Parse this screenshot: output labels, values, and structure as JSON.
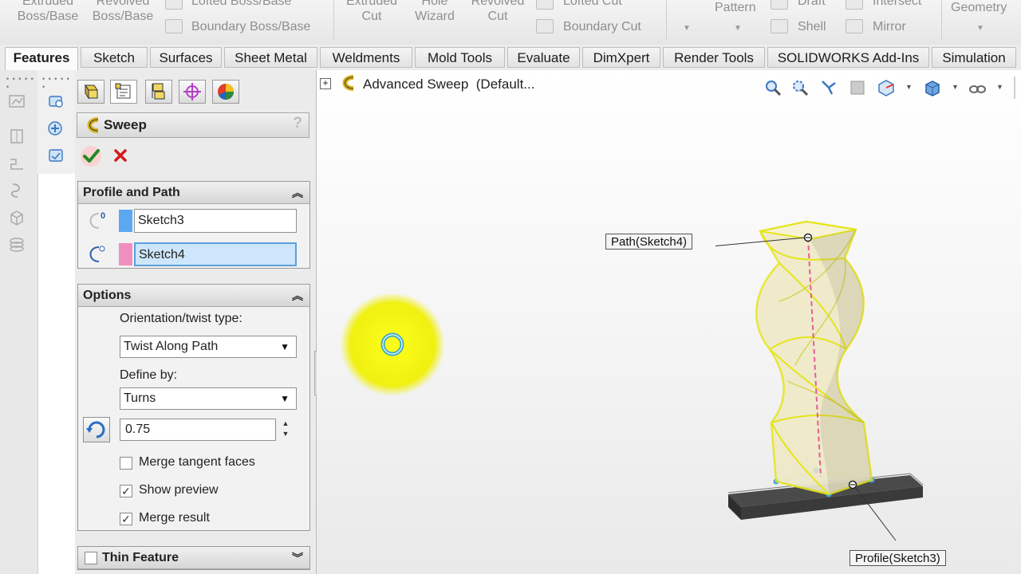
{
  "ribbon": {
    "extruded_boss": "Extruded\nBoss/Base",
    "revolved_boss": "Revolved\nBoss/Base",
    "lofted_boss": "Lofted Boss/Base",
    "boundary_boss": "Boundary Boss/Base",
    "extruded_cut": "Extruded\nCut",
    "hole_wizard": "Hole\nWizard",
    "revolved_cut": "Revolved\nCut",
    "lofted_cut": "Lofted Cut",
    "boundary_cut": "Boundary Cut",
    "pattern": "Pattern",
    "draft": "Draft",
    "shell": "Shell",
    "intersect": "Intersect",
    "mirror": "Mirror",
    "geometry": "Geometry"
  },
  "tabs": [
    {
      "label": "Features",
      "active": true
    },
    {
      "label": "Sketch"
    },
    {
      "label": "Surfaces"
    },
    {
      "label": "Sheet Metal"
    },
    {
      "label": "Weldments"
    },
    {
      "label": "Mold Tools"
    },
    {
      "label": "Evaluate"
    },
    {
      "label": "DimXpert"
    },
    {
      "label": "Render Tools"
    },
    {
      "label": "SOLIDWORKS Add-Ins"
    },
    {
      "label": "Simulation"
    }
  ],
  "property_manager": {
    "title": "Sweep",
    "help": "?",
    "profile_and_path": {
      "header": "Profile and Path",
      "profile_value": "Sketch3",
      "profile_color": "#5aa9f0",
      "path_value": "Sketch4",
      "path_color": "#f08fbf",
      "profile_badge": "0"
    },
    "options": {
      "header": "Options",
      "orientation_label": "Orientation/twist type:",
      "orientation_value": "Twist Along Path",
      "define_label": "Define by:",
      "define_value": "Turns",
      "turns_value": "0.75",
      "merge_tangent_label": "Merge tangent faces",
      "merge_tangent_checked": false,
      "show_preview_label": "Show preview",
      "show_preview_checked": true,
      "merge_result_label": "Merge result",
      "merge_result_checked": true
    },
    "thin_feature": {
      "header": "Thin Feature",
      "checked": false
    }
  },
  "graphics": {
    "tree_item": "Advanced Sweep  (Default...",
    "path_callout": "Path(Sketch4)",
    "profile_callout": "Profile(Sketch3)"
  },
  "colors": {
    "accent_yellow": "#ffff33",
    "preview_fill": "#efe9c4",
    "path_pink": "#e85a9a",
    "profile_blue": "#3aa0e8",
    "ok_green": "#2e9e2e",
    "cancel_red": "#d21a1a"
  }
}
